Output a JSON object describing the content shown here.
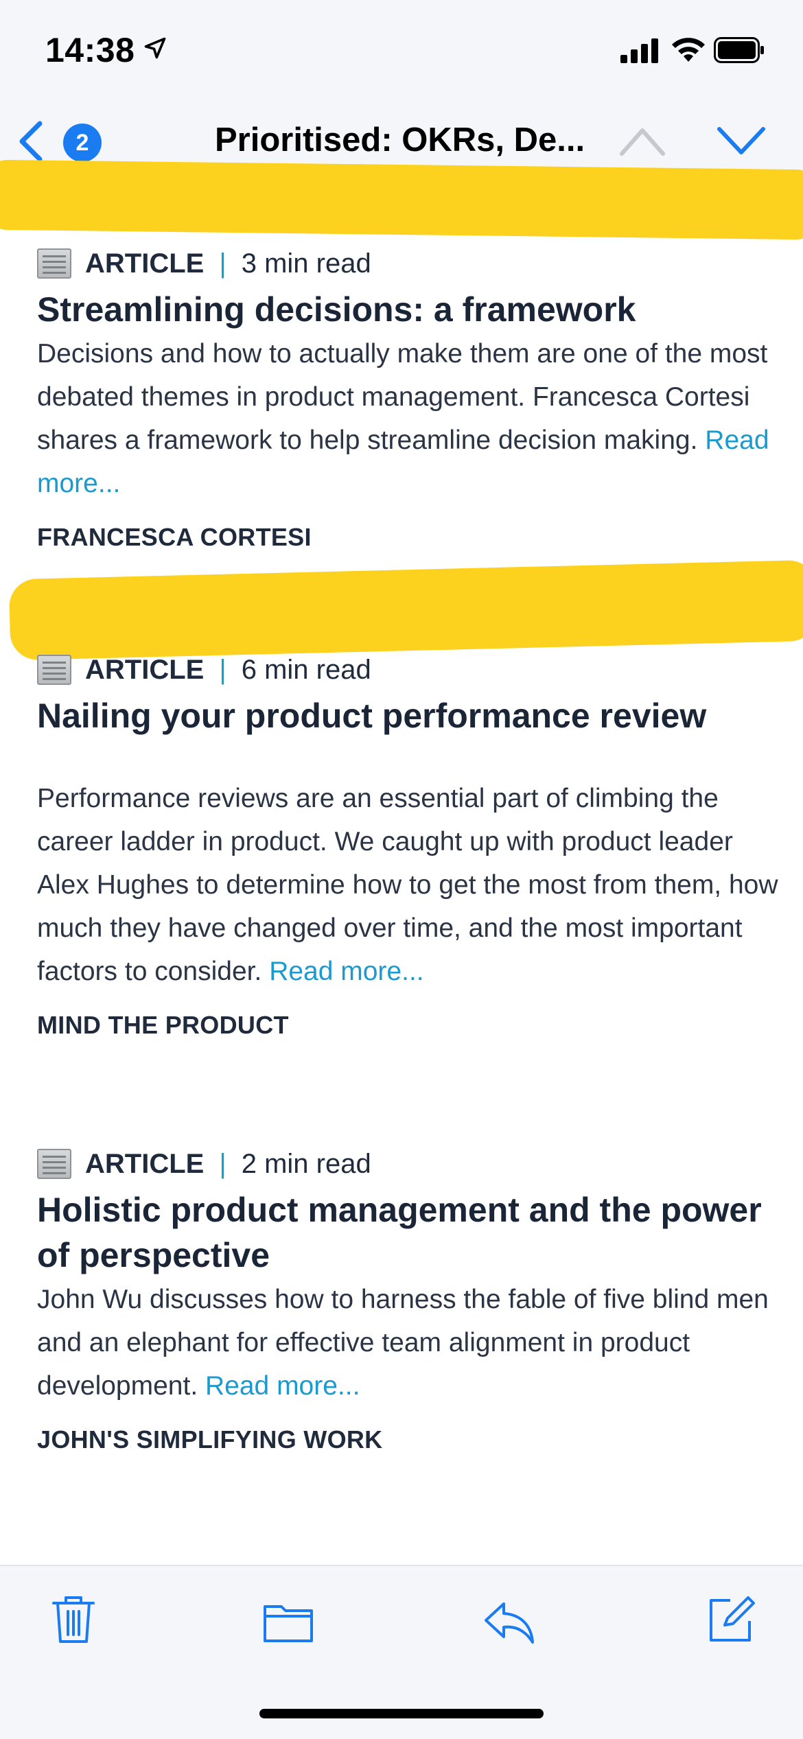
{
  "status_bar": {
    "time": "14:38",
    "icons": [
      "location-arrow-icon",
      "cellular-signal-icon",
      "wifi-icon",
      "battery-icon"
    ]
  },
  "nav": {
    "back_icon": "chevron-left-icon",
    "unread_count": "2",
    "subject": "Prioritised: OKRs, De...",
    "prev_icon": "chevron-up-icon",
    "next_icon": "chevron-down-icon"
  },
  "articles": [
    {
      "type": "ARTICLE",
      "separator": "|",
      "read_time": "3 min read",
      "title": "Streamlining decisions: a framework",
      "description": "Decisions and how to actually make them are one of the most debated themes in product management. Francesca Cortesi shares a framework to help streamline decision making.",
      "read_more": "Read more...",
      "author": "FRANCESCA CORTESI"
    },
    {
      "type": "ARTICLE",
      "separator": "|",
      "read_time": "6 min read",
      "title": "Nailing your product performance review",
      "description": "Performance reviews are an essential part of climbing the career ladder in product. We caught up with product leader Alex Hughes to determine how to get the most from them, how much they have changed over time, and the most important factors to consider.",
      "read_more": "Read more...",
      "author": "MIND THE PRODUCT"
    },
    {
      "type": "ARTICLE",
      "separator": "|",
      "read_time": "2 min read",
      "title": "Holistic product management and the power of perspective",
      "description": "John Wu discusses how to harness the fable of five blind men and an elephant for effective team alignment in product development.",
      "read_more": "Read more...",
      "author": "JOHN'S SIMPLIFYING WORK"
    }
  ],
  "toolbar": {
    "icons": [
      "trash-icon",
      "folder-icon",
      "reply-icon",
      "compose-icon"
    ]
  },
  "colors": {
    "accent": "#1a7cf0",
    "link": "#1a9bcf",
    "highlight": "#fdd21f",
    "text": "#1f2a3c"
  }
}
